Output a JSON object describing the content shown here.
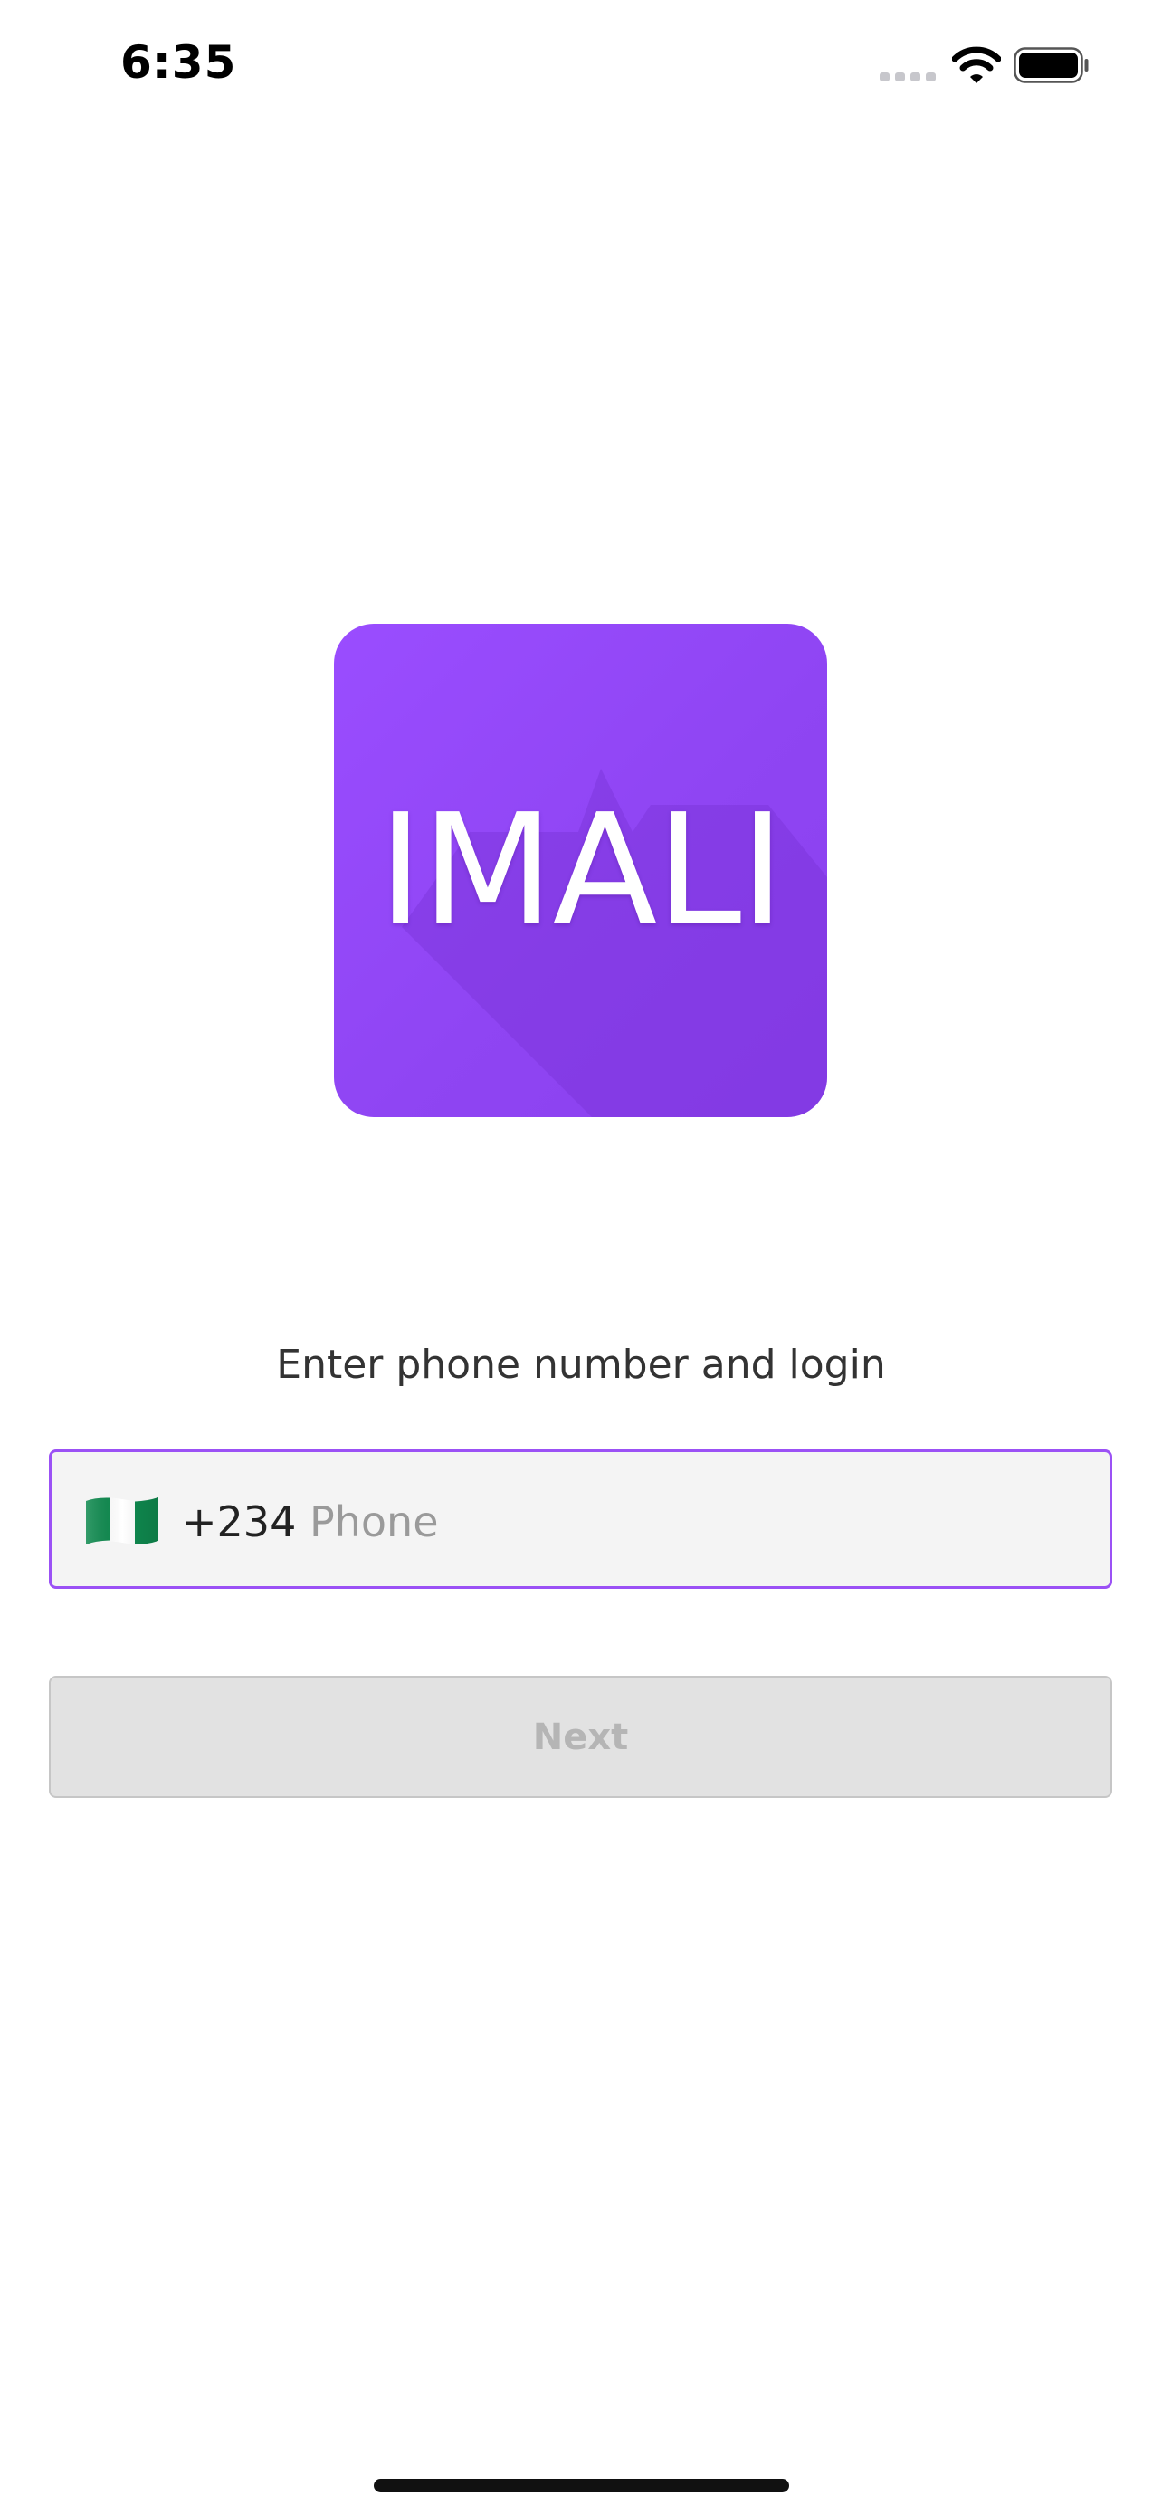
{
  "status_bar": {
    "time": "6:35",
    "signal_icon": "signal-icon",
    "wifi_icon": "wifi-icon",
    "battery_icon": "battery-icon"
  },
  "logo": {
    "text": "IMALI",
    "color": "#9347f7"
  },
  "login": {
    "prompt": "Enter phone number and login",
    "country_flag_icon": "nigeria-flag-icon",
    "dial_code": "+234",
    "phone_value": "",
    "phone_placeholder": "Phone",
    "field_border_color": "#9b51f5",
    "next_label": "Next",
    "next_enabled": false
  }
}
